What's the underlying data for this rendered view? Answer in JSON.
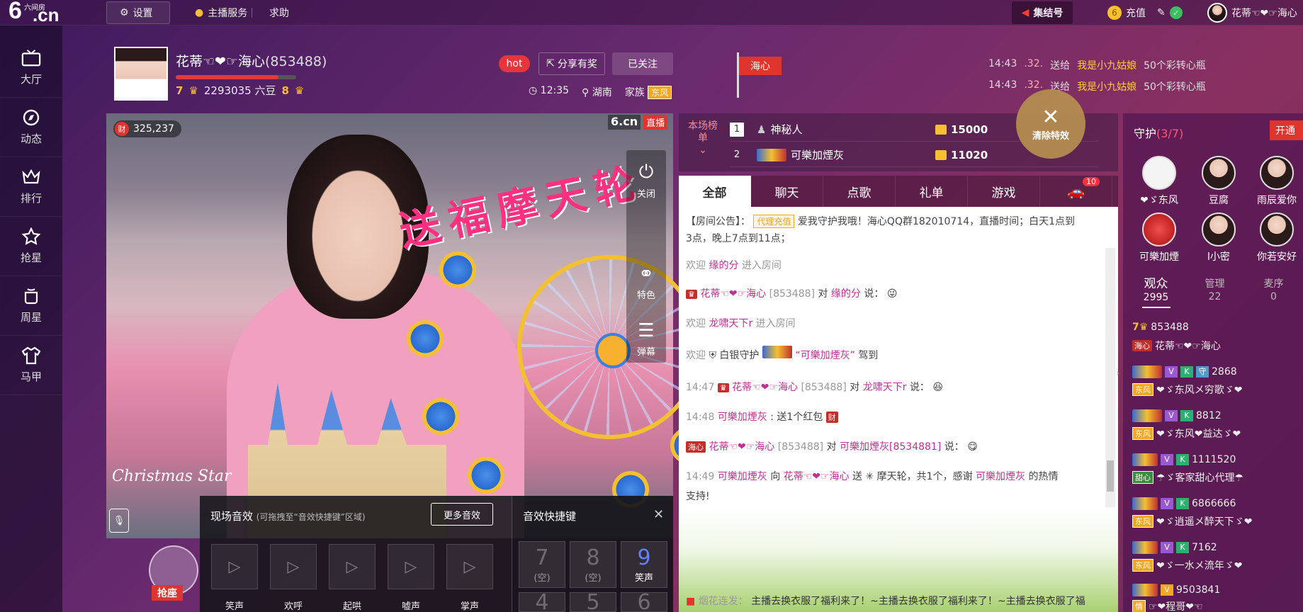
{
  "topbar": {
    "logo_six": "6",
    "logo_cn": ".cn",
    "logo_sub": "六间房",
    "settings": "设置",
    "anchor_service": "主播服务",
    "help": "求助",
    "collect": "集结号",
    "recharge": "充值",
    "username": "花蒂☜❤☞海心"
  },
  "sidebar": [
    {
      "label": "大厅",
      "icon": "tv-icon"
    },
    {
      "label": "动态",
      "icon": "compass-icon"
    },
    {
      "label": "排行",
      "icon": "crown-icon"
    },
    {
      "label": "抢星",
      "icon": "star-icon"
    },
    {
      "label": "周星",
      "icon": "cup-icon"
    },
    {
      "label": "马甲",
      "icon": "shirt-icon"
    }
  ],
  "anchor": {
    "name": "花蒂☜❤☞海心",
    "id": "(853488)",
    "level": "7",
    "beans": "2293035 六豆",
    "rich_level": "8",
    "hot": "hot",
    "share": "分享有奖",
    "follow": "已关注",
    "time": "12:35",
    "location": "湖南",
    "family_label": "家族",
    "family_tag": "东风",
    "progress": 0.85
  },
  "flag_label": "海心",
  "gift_feed": [
    {
      "time": "14:43",
      "num": ".32.",
      "verb": "送给",
      "user": "我是小九姑娘",
      "gift": "50个彩转心瓶"
    },
    {
      "time": "14:43",
      "num": ".32.",
      "verb": "送给",
      "user": "我是小九姑娘",
      "gift": "50个彩转心瓶"
    }
  ],
  "video": {
    "viewers": "325,237",
    "cai": "财",
    "site_logo": "6.cn",
    "live": "直播",
    "fx_text": "送福摩天轮",
    "christmas": "Christmas Star",
    "tools": [
      {
        "icon": "power-icon",
        "label": "关闭"
      },
      {
        "icon": "effect-icon",
        "label": "特色"
      },
      {
        "icon": "barrage-icon",
        "label": "弹幕"
      }
    ],
    "grab_seat": "抢座"
  },
  "sfx_panel": {
    "title": "现场音效",
    "hint": "(可拖拽至“音效快捷键”区域)",
    "more": "更多音效",
    "buttons": [
      "笑声",
      "欢呼",
      "起哄",
      "嘘声",
      "掌声"
    ]
  },
  "hotkeys": {
    "title": "音效快捷键",
    "keys": [
      {
        "num": "7",
        "label": "(空)"
      },
      {
        "num": "8",
        "label": "(空)"
      },
      {
        "num": "9",
        "label": "笑声"
      },
      {
        "num": "4",
        "label": ""
      },
      {
        "num": "5",
        "label": ""
      },
      {
        "num": "6",
        "label": ""
      }
    ]
  },
  "ranking": {
    "label": "本场榜单",
    "rows": [
      {
        "rank": "1",
        "name": "神秘人",
        "score": "15000"
      },
      {
        "rank": "2",
        "name": "可樂加煙灰",
        "score": "11020"
      }
    ],
    "clear_fx": "清除特效"
  },
  "chat_tabs": [
    "全部",
    "聊天",
    "点歌",
    "礼单",
    "游戏"
  ],
  "car_badge": "10",
  "chat": {
    "notice_prefix": "【房间公告】：",
    "notice_tag": "代理充值",
    "notice_text": "爱我守护我哦！海心QQ群182010714，直播时间；白天1点到",
    "notice_text2": "3点，晚上7点到11点；",
    "welcome1_pre": "欢迎",
    "welcome1_user": "缘的分",
    "welcome1_post": "进入房间",
    "msg1_user": "花蒂☜❤☞海心",
    "msg1_id": "[853488]",
    "msg1_to": "对",
    "msg1_target": "缘的分",
    "msg1_say": "说：",
    "welcome2_pre": "欢迎",
    "welcome2_user": "龙啸天下r",
    "welcome2_post": "进入房间",
    "welcome3_pre": "欢迎",
    "welcome3_guard": "白银守护",
    "welcome3_user": "“可樂加煙灰”",
    "welcome3_post": "驾到",
    "msg2_time": "14:47",
    "msg2_user": "花蒂☜❤☞海心",
    "msg2_id": "[853488]",
    "msg2_to": "对",
    "msg2_target": "龙啸天下r",
    "msg2_say": "说：",
    "msg3_time": "14:48",
    "msg3_user": "可樂加煙灰",
    "msg3_text": ": 送1个红包",
    "msg3_badge": "财",
    "msg4_user": "花蒂☜❤☞海心",
    "msg4_id": "[853488]",
    "msg4_to": "对",
    "msg4_target": "可樂加煙灰[8534881]",
    "msg4_say": "说：",
    "msg5_time": "14:49",
    "msg5_user": "可樂加煙灰",
    "msg5_to": "向",
    "msg5_target": "花蒂☜❤☞海心",
    "msg5_send": "送",
    "msg5_gift": "摩天轮，共1个，感谢",
    "msg5_user2": "可樂加煙灰",
    "msg5_end": "的热情",
    "msg5_end2": "支持!",
    "firework_label": "烟花连发：",
    "firework_text": "主播去换衣服了福利来了！~主播去换衣服了福利来了！~主播去换衣服了福"
  },
  "guard": {
    "title": "守护",
    "count": "(3/7)",
    "open": "开通",
    "members": [
      {
        "name": "❤ゞ东风"
      },
      {
        "name": "豆腐"
      },
      {
        "name": "雨辰爱你"
      },
      {
        "name": "可樂加煙"
      },
      {
        "name": "l小密"
      },
      {
        "name": "你若安好"
      }
    ]
  },
  "user_tabs": [
    {
      "label": "观众",
      "count": "2995"
    },
    {
      "label": "管理",
      "count": "22"
    },
    {
      "label": "麦序",
      "count": "0"
    }
  ],
  "users": [
    {
      "id": "853488",
      "name": "花蒂☜❤☞海心",
      "tag": "海心"
    },
    {
      "id": "2868",
      "name": "❤ゞ东风メ穷歌ゞ❤",
      "tag": "东风"
    },
    {
      "id": "8812",
      "name": "❤ゞ东风❤益达ゞ❤",
      "tag": "东风"
    },
    {
      "id": "1111520",
      "name": "☂ゞ客家甜心代理☂",
      "tag": "甜心"
    },
    {
      "id": "6866666",
      "name": "❤ゞ逍遥メ醉天下ゞ❤",
      "tag": "东风"
    },
    {
      "id": "7162",
      "name": "❤ゞ一水メ流年ゞ❤",
      "tag": "东风"
    },
    {
      "id": "9503841",
      "name": "☞❤程哥❤☜",
      "tag": "情"
    }
  ],
  "colors": {
    "accent": "#e0352d",
    "purple": "#6a2a6e",
    "gold": "#f7c030",
    "username": "#c03090"
  }
}
